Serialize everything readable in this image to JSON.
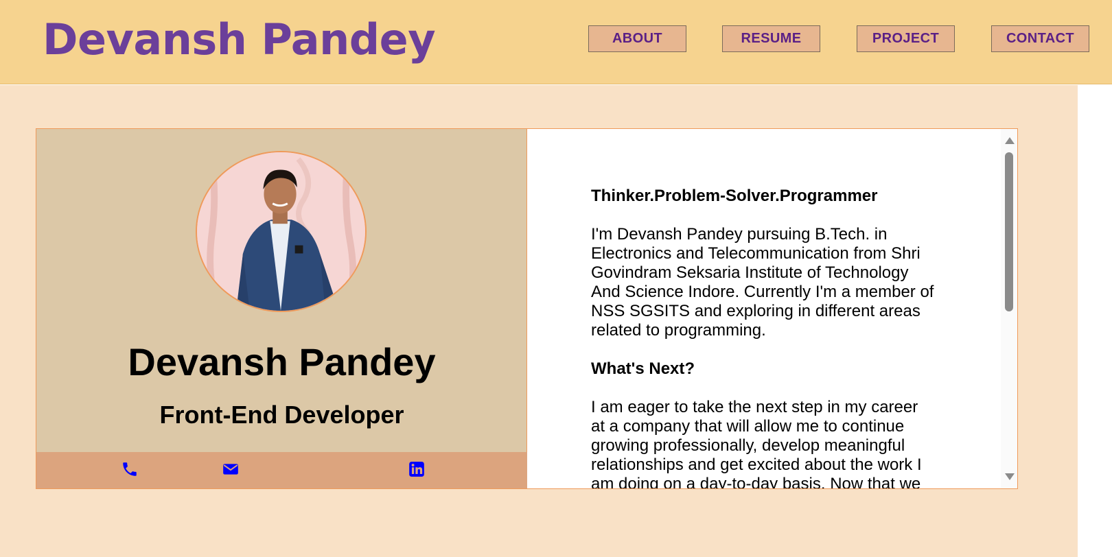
{
  "header": {
    "brand": "Devansh Pandey",
    "nav": [
      {
        "label": "ABOUT"
      },
      {
        "label": "RESUME"
      },
      {
        "label": "PROJECT"
      },
      {
        "label": "CONTACT"
      }
    ]
  },
  "profile": {
    "name": "Devansh Pandey",
    "role": "Front-End Developer",
    "social": [
      {
        "icon": "phone-icon"
      },
      {
        "icon": "email-icon"
      },
      {
        "icon": "linkedin-icon"
      }
    ]
  },
  "about": {
    "tagline": "Thinker.Problem-Solver.Programmer",
    "intro": "I'm Devansh Pandey pursuing B.Tech. in Electronics and Telecommunication from Shri Govindram Seksaria Institute of Technology And Science Indore. Currently I'm a member of NSS SGSITS and exploring in different areas related to programming.",
    "next_heading": "What's Next?",
    "next_text": "I am eager to take the next step in my career at a company that will allow me to continue growing professionally, develop meaningful relationships and get excited about the work I am doing on a day-to-day basis. Now that we"
  },
  "colors": {
    "header_bg": "#f6d38f",
    "brand": "#6b3f9a",
    "nav_bg": "#e7b690",
    "page_bg": "#f9e1c6",
    "left_panel": "#dcc8a7",
    "social_bar": "#dca47e",
    "icon": "#0000ff"
  }
}
